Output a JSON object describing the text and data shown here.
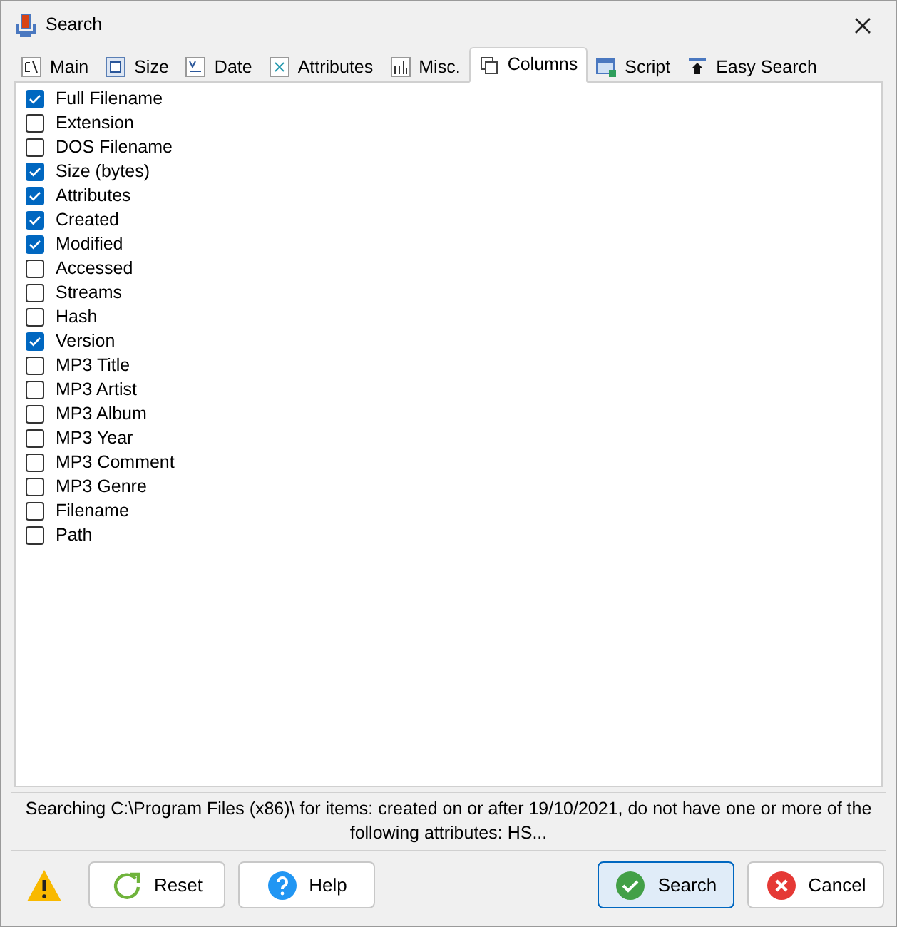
{
  "window": {
    "title": "Search"
  },
  "tabs": [
    {
      "label": "Main",
      "kind": "drive",
      "selected": false
    },
    {
      "label": "Size",
      "kind": "size",
      "selected": false
    },
    {
      "label": "Date",
      "kind": "date",
      "selected": false
    },
    {
      "label": "Attributes",
      "kind": "attributes",
      "selected": false
    },
    {
      "label": "Misc.",
      "kind": "misc",
      "selected": false
    },
    {
      "label": "Columns",
      "kind": "columns",
      "selected": true
    },
    {
      "label": "Script",
      "kind": "script",
      "selected": false
    },
    {
      "label": "Easy Search",
      "kind": "easy",
      "selected": false
    }
  ],
  "columns": [
    {
      "label": "Full Filename",
      "checked": true
    },
    {
      "label": "Extension",
      "checked": false
    },
    {
      "label": "DOS Filename",
      "checked": false
    },
    {
      "label": "Size (bytes)",
      "checked": true
    },
    {
      "label": "Attributes",
      "checked": true
    },
    {
      "label": "Created",
      "checked": true
    },
    {
      "label": "Modified",
      "checked": true
    },
    {
      "label": "Accessed",
      "checked": false
    },
    {
      "label": "Streams",
      "checked": false
    },
    {
      "label": "Hash",
      "checked": false
    },
    {
      "label": "Version",
      "checked": true
    },
    {
      "label": "MP3 Title",
      "checked": false
    },
    {
      "label": "MP3 Artist",
      "checked": false
    },
    {
      "label": "MP3 Album",
      "checked": false
    },
    {
      "label": "MP3 Year",
      "checked": false
    },
    {
      "label": "MP3 Comment",
      "checked": false
    },
    {
      "label": "MP3 Genre",
      "checked": false
    },
    {
      "label": "Filename",
      "checked": false
    },
    {
      "label": "Path",
      "checked": false
    }
  ],
  "status": "Searching C:\\Program Files (x86)\\ for items: created on or after 19/10/2021, do not have one or more of the following attributes: HS...",
  "buttons": [
    {
      "label": "Reset",
      "kind": "reset",
      "default": false
    },
    {
      "label": "Help",
      "kind": "help",
      "default": false
    },
    {
      "label": "Search",
      "kind": "search",
      "default": true
    },
    {
      "label": "Cancel",
      "kind": "cancel",
      "default": false
    }
  ]
}
